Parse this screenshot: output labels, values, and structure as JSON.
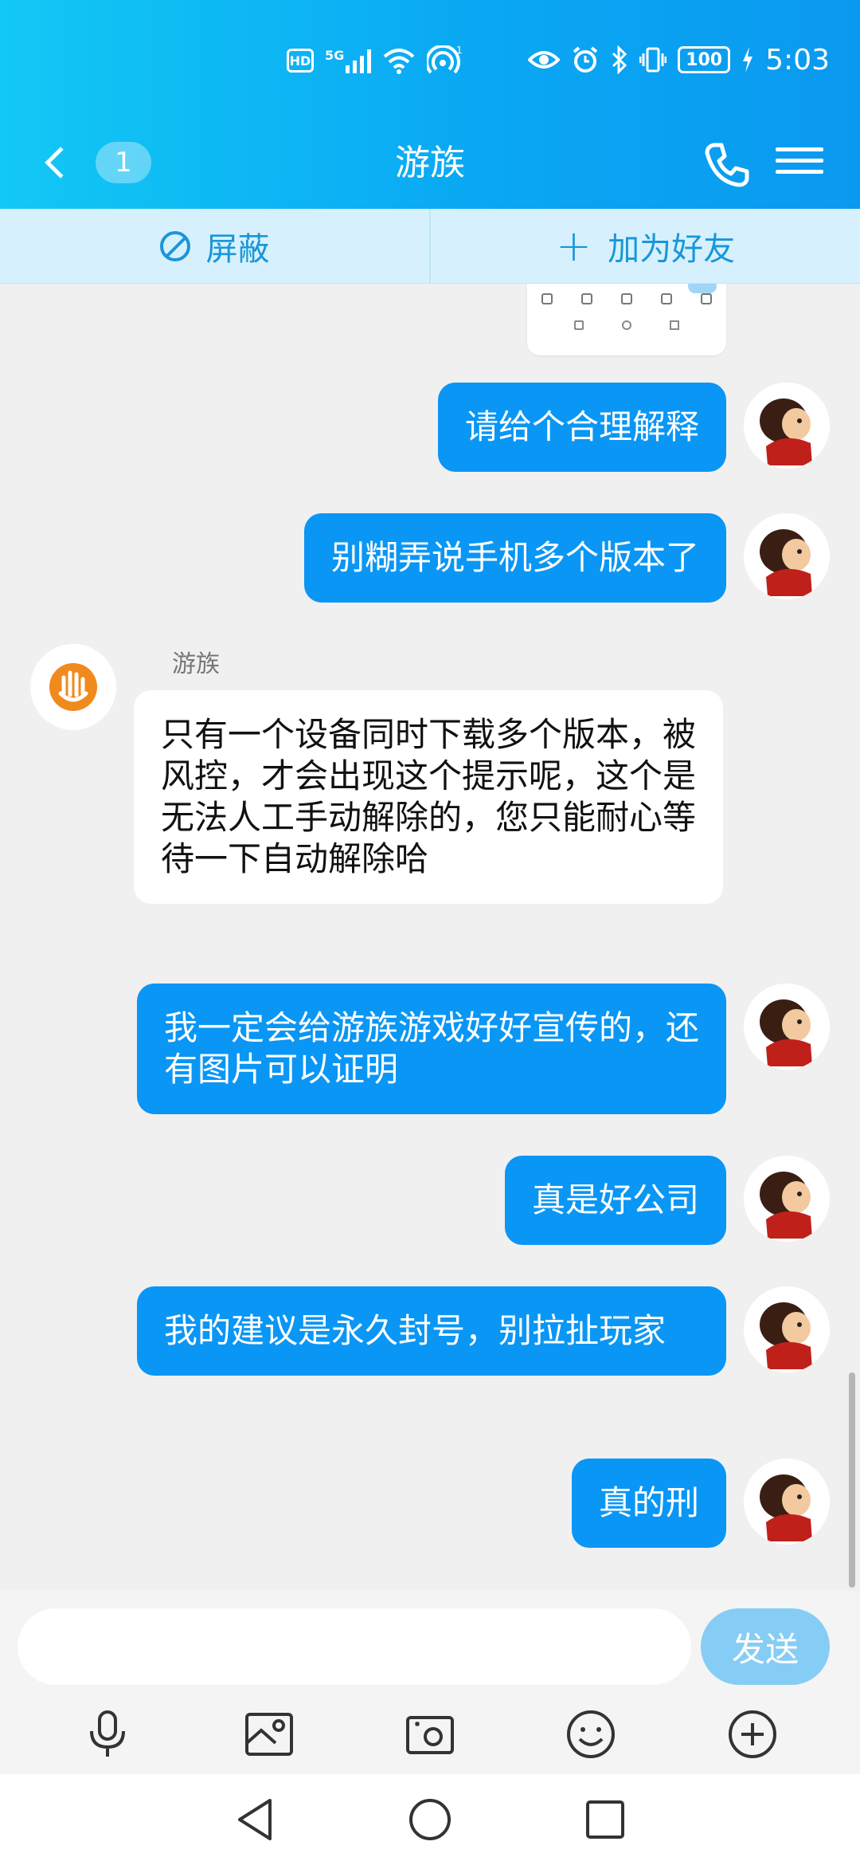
{
  "status_bar": {
    "hd": "HD",
    "network": "5G",
    "battery": "100",
    "time": "5:03"
  },
  "header": {
    "unread_count": "1",
    "title": "游族"
  },
  "action_bar": {
    "block_label": "屏蔽",
    "add_friend_label": "加为好友"
  },
  "messages": [
    {
      "dir": "out",
      "text": "请给个合理解释"
    },
    {
      "dir": "out",
      "text": "别糊弄说手机多个版本了"
    },
    {
      "dir": "in",
      "sender": "游族",
      "text": "只有一个设备同时下载多个版本，被风控，才会出现这个提示呢，这个是无法人工手动解除的，您只能耐心等待一下自动解除哈"
    },
    {
      "dir": "out",
      "text": "我一定会给游族游戏好好宣传的，还有图片可以证明"
    },
    {
      "dir": "out",
      "text": "真是好公司"
    },
    {
      "dir": "out",
      "text": "我的建议是永久封号，别拉扯玩家"
    },
    {
      "dir": "out",
      "text": "真的刑"
    }
  ],
  "input": {
    "value": "",
    "send_label": "发送"
  },
  "colors": {
    "accent": "#0a96f5",
    "header_gradient_start": "#12c8f5",
    "header_gradient_end": "#0a99f0",
    "vendor_logo": "#f08a1c"
  }
}
